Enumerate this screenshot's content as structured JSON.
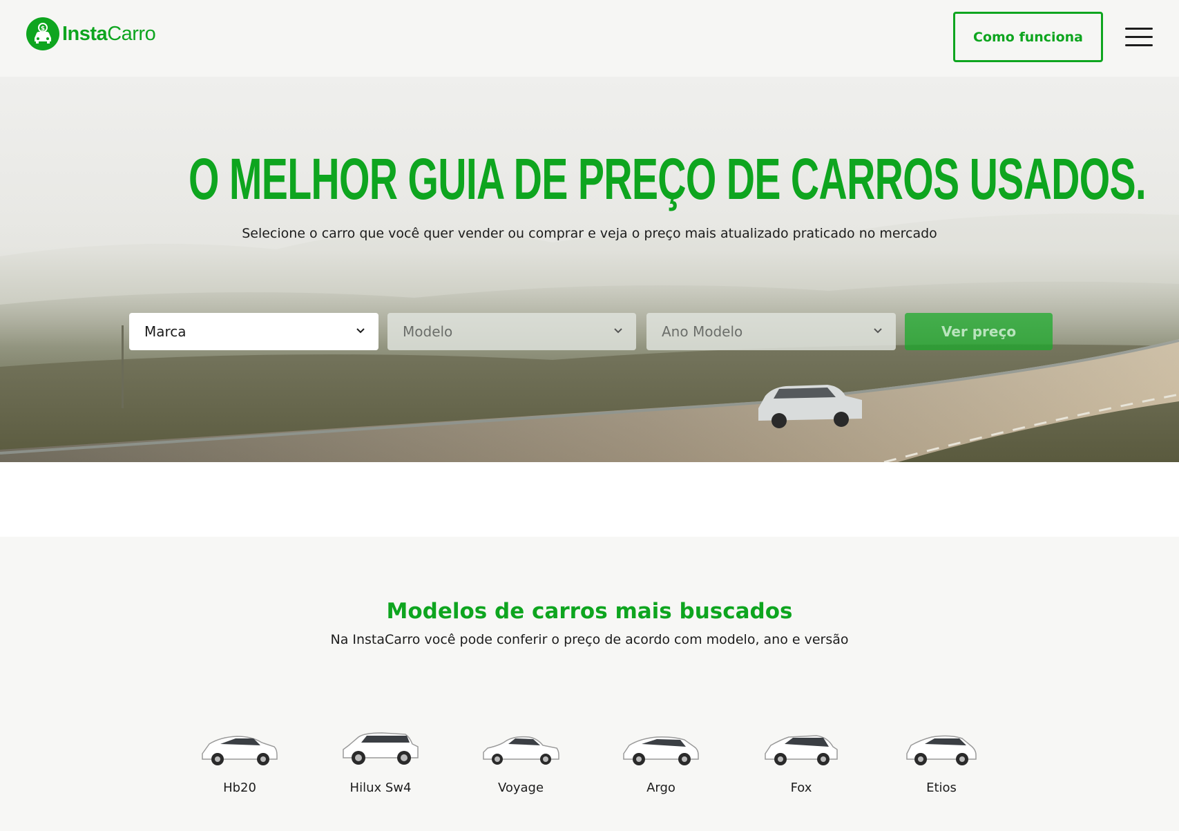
{
  "header": {
    "logo_bold": "Insta",
    "logo_regular": "Carro",
    "how_it_works_label": "Como funciona"
  },
  "hero": {
    "title": "O MELHOR GUIA DE PREÇO DE CARROS USADOS.",
    "subtitle": "Selecione o carro que você quer vender ou comprar e veja o preço mais atualizado praticado no mercado",
    "brand_select": "Marca",
    "model_select": "Modelo",
    "year_select": "Ano Modelo",
    "price_button": "Ver preço"
  },
  "popular_models": {
    "title": "Modelos de carros mais buscados",
    "subtitle": "Na InstaCarro você pode conferir o preço de acordo com modelo, ano e versão",
    "cars": [
      {
        "label": "Hb20",
        "icon": "hatchback-car-icon"
      },
      {
        "label": "Hilux Sw4",
        "icon": "suv-car-icon"
      },
      {
        "label": "Voyage",
        "icon": "sedan-car-icon"
      },
      {
        "label": "Argo",
        "icon": "hatchback-car-icon"
      },
      {
        "label": "Fox",
        "icon": "hatchback-car-icon"
      },
      {
        "label": "Etios",
        "icon": "hatchback-car-icon"
      }
    ]
  },
  "colors": {
    "brand_green": "#0ea51f",
    "text_dark": "#1c1c1c",
    "header_bg": "#f6f6f4"
  }
}
